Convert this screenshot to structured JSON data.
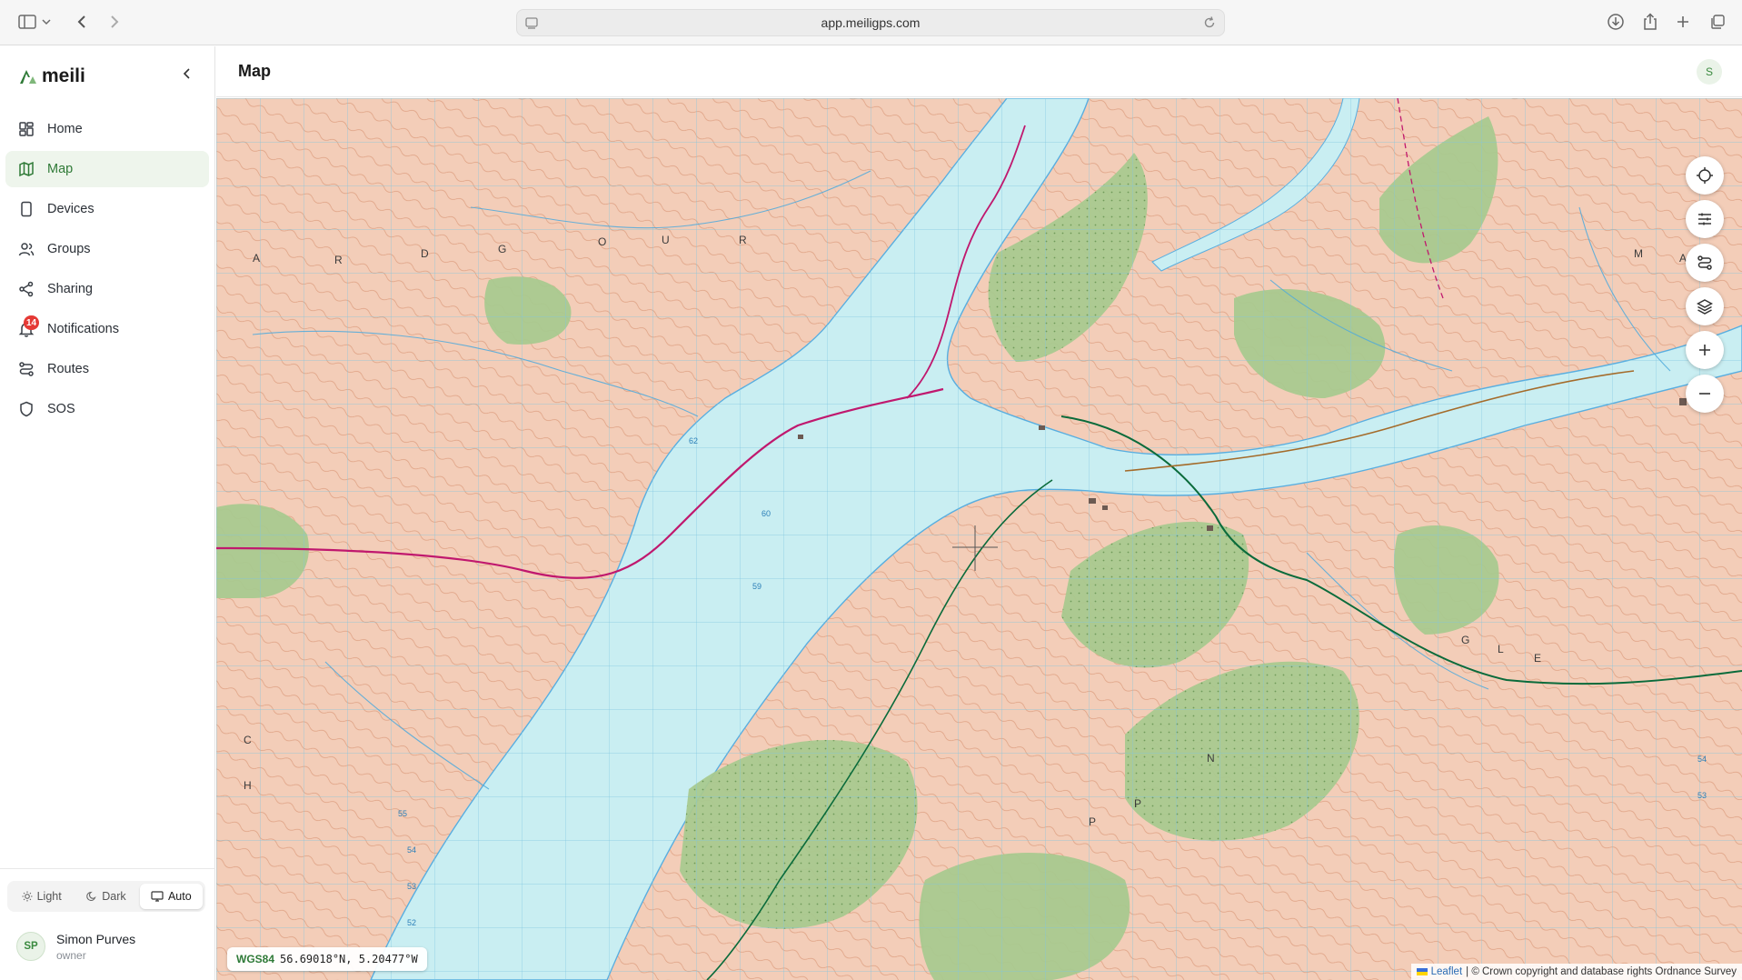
{
  "browser": {
    "url": "app.meiligps.com"
  },
  "brand": {
    "name": "meili",
    "accent": "#2f7a37"
  },
  "sidebar": {
    "items": [
      {
        "label": "Home",
        "icon": "grid-icon"
      },
      {
        "label": "Map",
        "icon": "map-icon",
        "active": true
      },
      {
        "label": "Devices",
        "icon": "device-icon"
      },
      {
        "label": "Groups",
        "icon": "users-icon"
      },
      {
        "label": "Sharing",
        "icon": "share-icon"
      },
      {
        "label": "Notifications",
        "icon": "bell-icon",
        "badge": "14"
      },
      {
        "label": "Routes",
        "icon": "route-icon"
      },
      {
        "label": "SOS",
        "icon": "shield-icon"
      }
    ],
    "theme": {
      "light": "Light",
      "dark": "Dark",
      "auto": "Auto",
      "selected": "Auto"
    },
    "user": {
      "initials": "SP",
      "name": "Simon Purves",
      "role": "owner"
    }
  },
  "header": {
    "title": "Map",
    "avatar": "S"
  },
  "map": {
    "coords": {
      "system": "WGS84",
      "value": "56.69018°N, 5.20477°W"
    },
    "attribution": {
      "leaflet": "Leaflet",
      "text": "| © Crown copyright and database rights Ordnance Survey"
    },
    "controls": [
      "locate-icon",
      "filter-icon",
      "route-icon",
      "layers-icon",
      "zoom-in-icon",
      "zoom-out-icon"
    ],
    "colors": {
      "water": "#c9eef2",
      "land": "#f3cdb8",
      "forest": "#a9c98f",
      "road": "#c0186e"
    }
  }
}
